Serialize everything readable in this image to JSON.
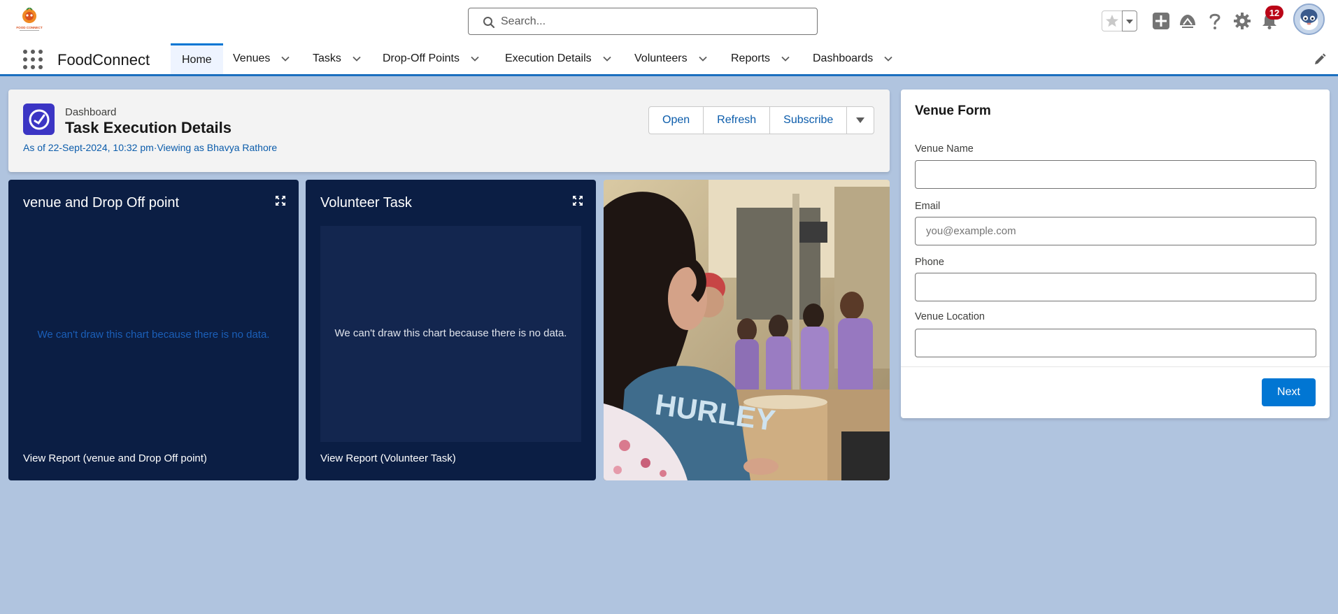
{
  "header": {
    "logo_text": "FOOD CONNECT",
    "search_placeholder": "Search...",
    "notification_count": "12",
    "icons": [
      "favorites-star-icon",
      "chevron-down-icon",
      "add-icon",
      "trailhead-icon",
      "help-icon",
      "setup-gear-icon",
      "bell-icon",
      "avatar"
    ]
  },
  "nav": {
    "app_name": "FoodConnect",
    "tabs": [
      {
        "label": "Home",
        "active": true
      },
      {
        "label": "Venues"
      },
      {
        "label": "Tasks"
      },
      {
        "label": "Drop-Off Points"
      },
      {
        "label": "Execution Details"
      },
      {
        "label": "Volunteers"
      },
      {
        "label": "Reports"
      },
      {
        "label": "Dashboards"
      }
    ]
  },
  "dashboard": {
    "type_label": "Dashboard",
    "title": "Task Execution Details",
    "as_of": "As of 22-Sept-2024, 10:32 pm·Viewing as Bhavya Rathore",
    "buttons": {
      "open": "Open",
      "refresh": "Refresh",
      "subscribe": "Subscribe"
    },
    "components": [
      {
        "title": "venue and Drop Off point",
        "message": "We can't draw this chart because there is no data.",
        "link": "View Report (venue and Drop Off point)"
      },
      {
        "title": "Volunteer Task",
        "message": "We can't draw this chart because there is no data.",
        "link": "View Report (Volunteer Task)"
      }
    ],
    "photo_text": "HURLEY"
  },
  "venue_form": {
    "title": "Venue Form",
    "fields": [
      {
        "label": "Venue Name",
        "value": "",
        "placeholder": ""
      },
      {
        "label": "Email",
        "value": "",
        "placeholder": "you@example.com"
      },
      {
        "label": "Phone",
        "value": "",
        "placeholder": ""
      },
      {
        "label": "Venue Location",
        "value": "",
        "placeholder": ""
      }
    ],
    "next_label": "Next"
  },
  "colors": {
    "brand_blue": "#0176d3",
    "dashboard_icon": "#3b35c4",
    "tile_bg": "#0b1e44",
    "page_bg": "#b0c4df",
    "notification_badge": "#ba0517"
  }
}
